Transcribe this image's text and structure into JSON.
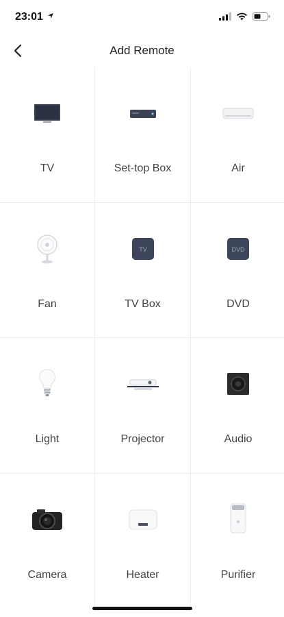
{
  "status": {
    "time": "23:01"
  },
  "nav": {
    "title": "Add Remote"
  },
  "devices": [
    {
      "label": "TV",
      "icon": "tv-icon"
    },
    {
      "label": "Set-top Box",
      "icon": "set-top-box-icon"
    },
    {
      "label": "Air",
      "icon": "air-conditioner-icon"
    },
    {
      "label": "Fan",
      "icon": "fan-icon"
    },
    {
      "label": "TV Box",
      "icon": "tv-box-icon",
      "badge": "TV"
    },
    {
      "label": "DVD",
      "icon": "dvd-icon",
      "badge": "DVD"
    },
    {
      "label": "Light",
      "icon": "light-bulb-icon"
    },
    {
      "label": "Projector",
      "icon": "projector-icon"
    },
    {
      "label": "Audio",
      "icon": "speaker-icon"
    },
    {
      "label": "Camera",
      "icon": "camera-icon"
    },
    {
      "label": "Heater",
      "icon": "heater-icon"
    },
    {
      "label": "Purifier",
      "icon": "purifier-icon"
    }
  ]
}
